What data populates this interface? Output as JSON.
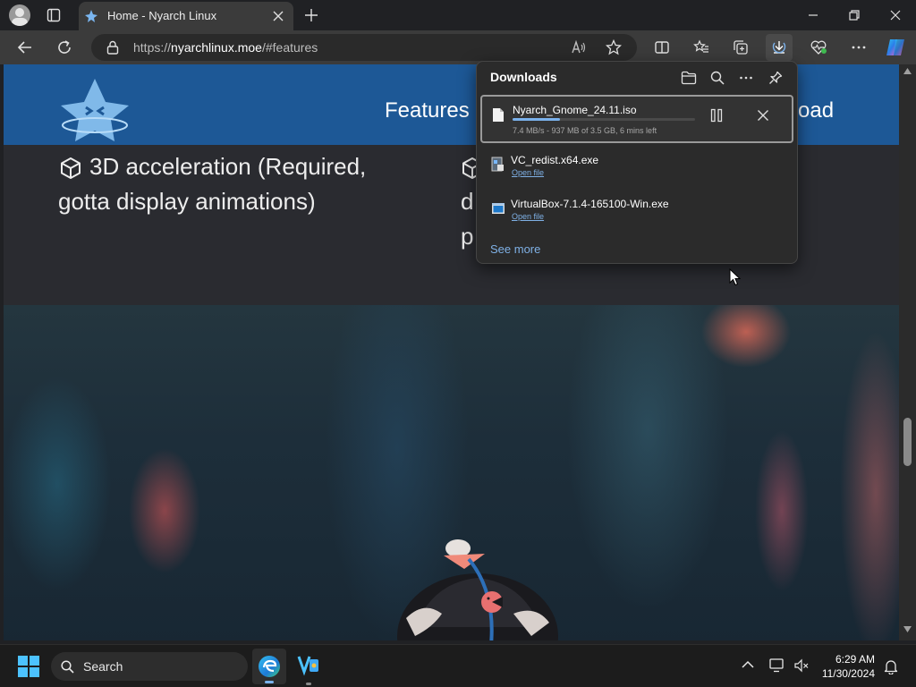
{
  "browser": {
    "tab_title": "Home - Nyarch Linux",
    "url_prefix": "https://",
    "url_host": "nyarchlinux.moe",
    "url_path": "/#features"
  },
  "site": {
    "nav": {
      "features": "Features",
      "download_partial": "oad"
    },
    "feature_left_line1": "3D acceleration (Required,",
    "feature_left_line2": "gotta display animations)",
    "feature_right_line2": "d",
    "feature_right_line3": "p"
  },
  "downloads": {
    "title": "Downloads",
    "items": [
      {
        "name": "Nyarch_Gnome_24.11.iso",
        "status": "7.4 MB/s - 937 MB of 3.5 GB, 6 mins left",
        "progress": 0.26
      },
      {
        "name": "VC_redist.x64.exe",
        "action": "Open file"
      },
      {
        "name": "VirtualBox-7.1.4-165100-Win.exe",
        "action": "Open file"
      }
    ],
    "see_more": "See more"
  },
  "taskbar": {
    "search_label": "Search",
    "time": "6:29 AM",
    "date": "11/30/2024"
  },
  "colors": {
    "accent": "#7fb1e6",
    "site_header": "#1d5896",
    "progress": "#7bb2ec"
  },
  "icons": [
    "profile-icon",
    "tab-actions-icon",
    "nyarch-logo-icon",
    "close-icon",
    "new-tab-icon",
    "back-icon",
    "refresh-icon",
    "lock-icon",
    "read-aloud-icon",
    "favorite-star-icon",
    "split-screen-icon",
    "favorites-icon",
    "collections-icon",
    "downloads-icon",
    "browser-essentials-icon",
    "more-icon",
    "copilot-icon",
    "folder-icon",
    "search-icon",
    "pin-icon",
    "file-icon",
    "pause-icon",
    "cube-icon",
    "windows-start-icon",
    "edge-icon",
    "chevron-up-icon",
    "notification-bell-icon"
  ]
}
